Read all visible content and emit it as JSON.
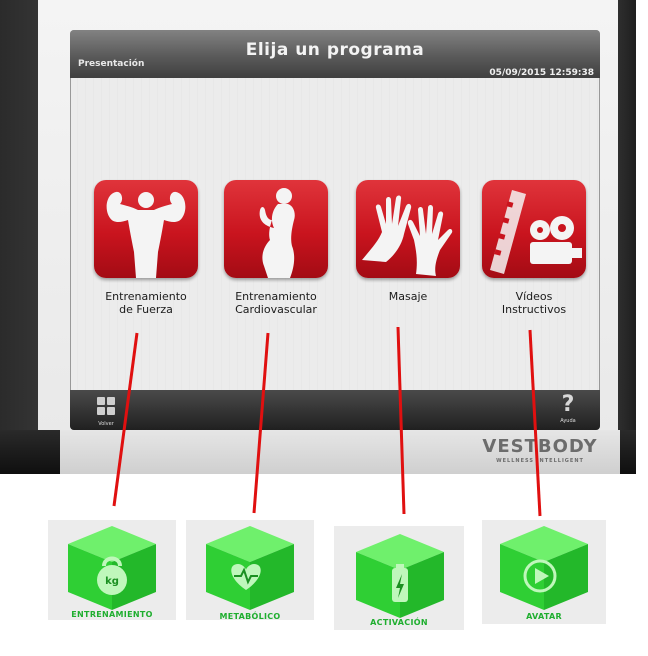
{
  "screen": {
    "title": "Elija un programa",
    "section": "Presentación",
    "datetime": "05/09/2015 12:59:38"
  },
  "programs": [
    {
      "label_line1": "Entrenamiento",
      "label_line2": "de Fuerza",
      "icon": "bodybuilder-icon"
    },
    {
      "label_line1": "Entrenamiento",
      "label_line2": "Cardiovascular",
      "icon": "woman-silhouette-icon"
    },
    {
      "label_line1": "Masaje",
      "label_line2": "",
      "icon": "hands-icon"
    },
    {
      "label_line1": "Vídeos",
      "label_line2": "Instructivos",
      "icon": "film-projector-icon"
    }
  ],
  "bottombar": {
    "back_label": "Volver",
    "help_label": "Ayuda",
    "help_glyph": "?"
  },
  "brand": {
    "name": "VESTBODY",
    "tagline": "WELLNESS INTELLIGENT"
  },
  "categories": [
    {
      "label": "ENTRENAMIENTO",
      "icon": "kettlebell-icon",
      "icon_text": "kg"
    },
    {
      "label": "METABÓLICO",
      "icon": "heart-pulse-icon"
    },
    {
      "label": "ACTIVACIÓN",
      "icon": "battery-bolt-icon"
    },
    {
      "label": "AVATAR",
      "icon": "play-icon"
    }
  ],
  "colors": {
    "tile_red": "#c9141e",
    "cube_green": "#35d43a",
    "connector_red": "#e01010",
    "category_text": "#1fae2f"
  }
}
